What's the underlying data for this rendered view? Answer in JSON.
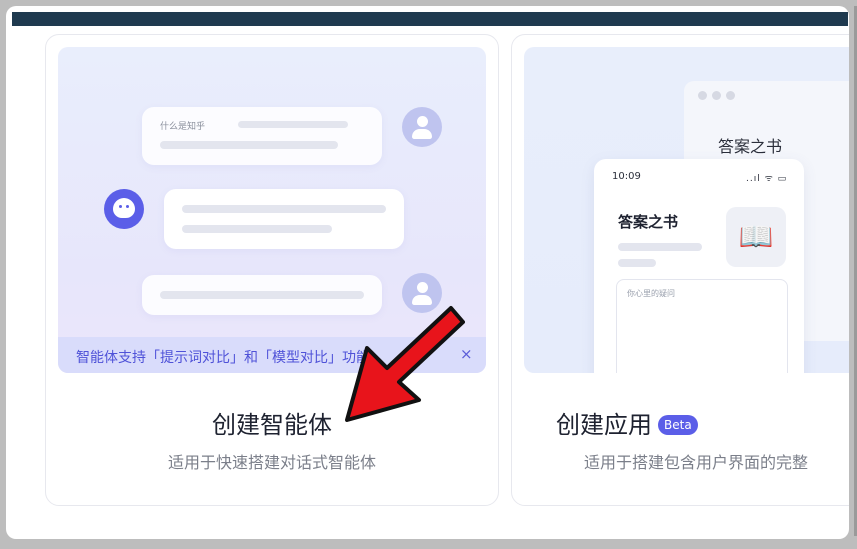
{
  "card_agent": {
    "chat_question": "什么是知乎",
    "banner_text": "智能体支持「提示词对比」和「模型对比」功能!",
    "banner_close": "×",
    "title": "创建智能体",
    "description": "适用于快速搭建对话式智能体"
  },
  "card_app": {
    "window_title": "答案之书",
    "phone_time": "10:09",
    "phone_status": "..ıl ᯤ ▭",
    "phone_title": "答案之书",
    "book_icon": "📖",
    "input_placeholder": "你心里的疑问",
    "title": "创建应用",
    "badge": "Beta",
    "description": "适用于搭建包含用户界面的完整"
  },
  "colors": {
    "accent": "#5b5ee8",
    "banner_bg": "#d9dcfb",
    "topbar": "#1f3a4f",
    "arrow": "#e8141b"
  }
}
